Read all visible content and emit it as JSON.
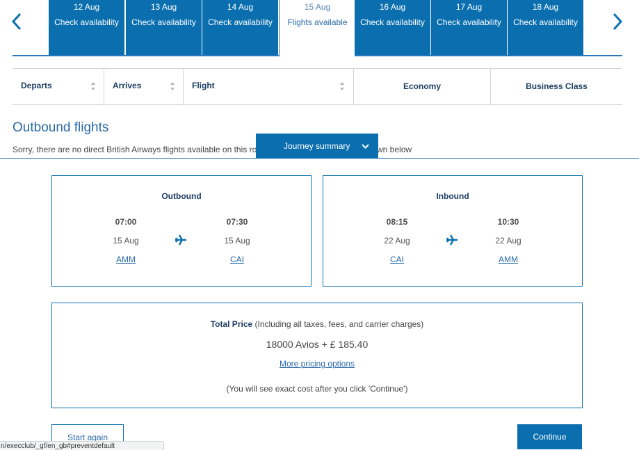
{
  "date_nav": {
    "prev_icon": "chevron-left-icon",
    "next_icon": "chevron-right-icon",
    "dates": [
      {
        "date": "12 Aug",
        "status": "Check availability",
        "active": false
      },
      {
        "date": "13 Aug",
        "status": "Check availability",
        "active": false
      },
      {
        "date": "14 Aug",
        "status": "Check availability",
        "active": false
      },
      {
        "date": "15 Aug",
        "status": "Flights available",
        "active": true
      },
      {
        "date": "16 Aug",
        "status": "Check availability",
        "active": false
      },
      {
        "date": "17 Aug",
        "status": "Check availability",
        "active": false
      },
      {
        "date": "18 Aug",
        "status": "Check availability",
        "active": false
      }
    ]
  },
  "columns": {
    "departs": "Departs",
    "arrives": "Arrives",
    "flight": "Flight",
    "economy": "Economy",
    "business": "Business Class"
  },
  "section_title": "Outbound flights",
  "notice_left": "Sorry, there are no direct British Airways flights available on this ro",
  "notice_right": "wn below",
  "journey_summary": {
    "label": "Journey summary",
    "icon": "chevron-down-icon"
  },
  "outbound": {
    "title": "Outbound",
    "depart_time": "07:00",
    "depart_date": "15 Aug",
    "depart_code": "AMM",
    "arrive_time": "07:30",
    "arrive_date": "15 Aug",
    "arrive_code": "CAI",
    "icon": "plane-icon"
  },
  "inbound": {
    "title": "Inbound",
    "depart_time": "08:15",
    "depart_date": "22 Aug",
    "depart_code": "CAI",
    "arrive_time": "10:30",
    "arrive_date": "22 Aug",
    "arrive_code": "AMM",
    "icon": "plane-icon"
  },
  "price": {
    "label": "Total Price",
    "qualifier": " (Including all taxes, fees, and carrier charges)",
    "value": "18000 Avios + £ 185.40",
    "more_link": "More pricing options",
    "note": "(You will see exact cost after you click 'Continue')"
  },
  "actions": {
    "start_again": "Start again",
    "continue": "Continue"
  },
  "status_bar_url": "n/execclub/_gf/en_gb#preventdefault",
  "colors": {
    "brand_blue": "#0b6faf",
    "link_blue": "#2a6aa8",
    "heading_navy": "#1f3f66"
  }
}
